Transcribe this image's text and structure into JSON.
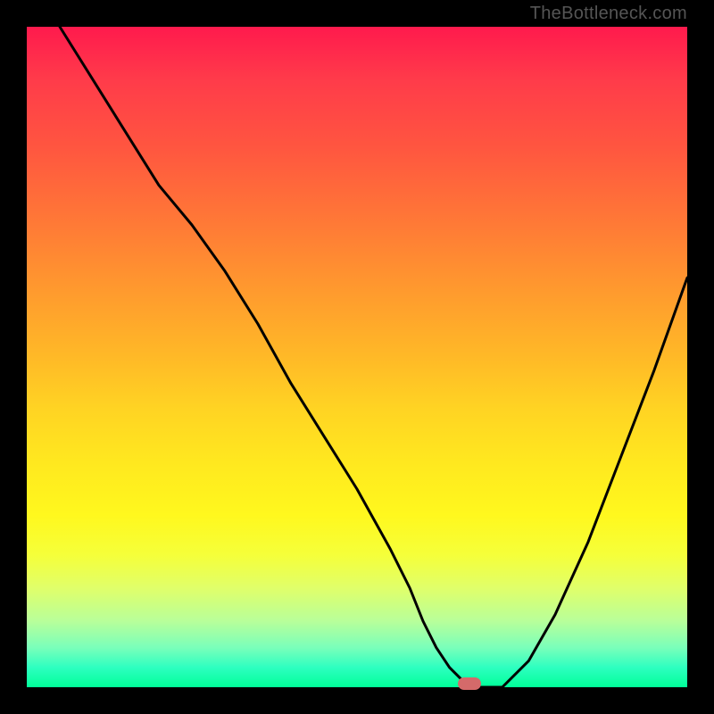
{
  "watermark": "TheBottleneck.com",
  "chart_data": {
    "type": "line",
    "title": "",
    "xlabel": "",
    "ylabel": "",
    "xlim": [
      0,
      100
    ],
    "ylim": [
      0,
      100
    ],
    "series": [
      {
        "name": "curve",
        "x": [
          5,
          10,
          15,
          20,
          25,
          30,
          35,
          40,
          45,
          50,
          55,
          58,
          60,
          62,
          64,
          66,
          68,
          72,
          76,
          80,
          85,
          90,
          95,
          100
        ],
        "y": [
          100,
          92,
          84,
          76,
          70,
          63,
          55,
          46,
          38,
          30,
          21,
          15,
          10,
          6,
          3,
          1,
          0,
          0,
          4,
          11,
          22,
          35,
          48,
          62
        ]
      }
    ],
    "marker": {
      "x": 67,
      "y": 0.5
    },
    "gradient_stops": [
      {
        "pct": 0,
        "color": "#ff1a4d"
      },
      {
        "pct": 50,
        "color": "#ffb927"
      },
      {
        "pct": 80,
        "color": "#f5ff3a"
      },
      {
        "pct": 100,
        "color": "#00ff99"
      }
    ]
  }
}
